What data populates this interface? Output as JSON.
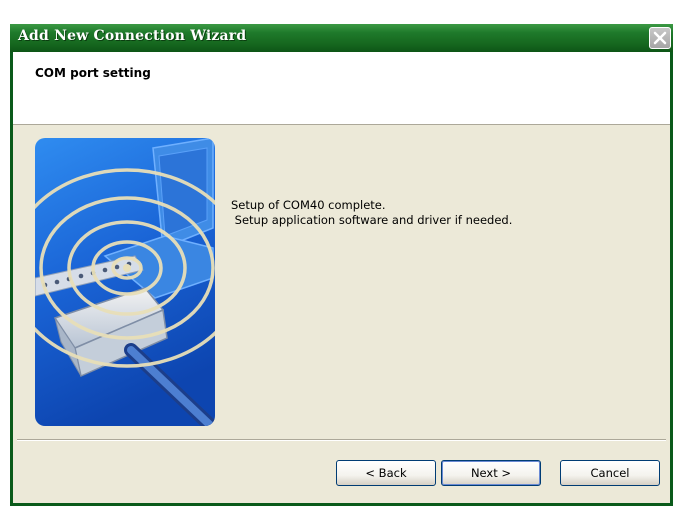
{
  "window": {
    "title": "Add New Connection Wizard"
  },
  "header": {
    "title": "COM port setting"
  },
  "body": {
    "message_line1": "Setup of COM40 complete.",
    "message_line2": " Setup application software and driver if needed."
  },
  "buttons": {
    "back_label": "< Back",
    "next_label": "Next >",
    "cancel_label": "Cancel"
  },
  "colors": {
    "titlebar": "#1f7a2b",
    "client_bg": "#ece9d8",
    "art_blue": "#1a64d6"
  },
  "icons": {
    "close": "close-icon",
    "art": "serial-cable-illustration"
  }
}
